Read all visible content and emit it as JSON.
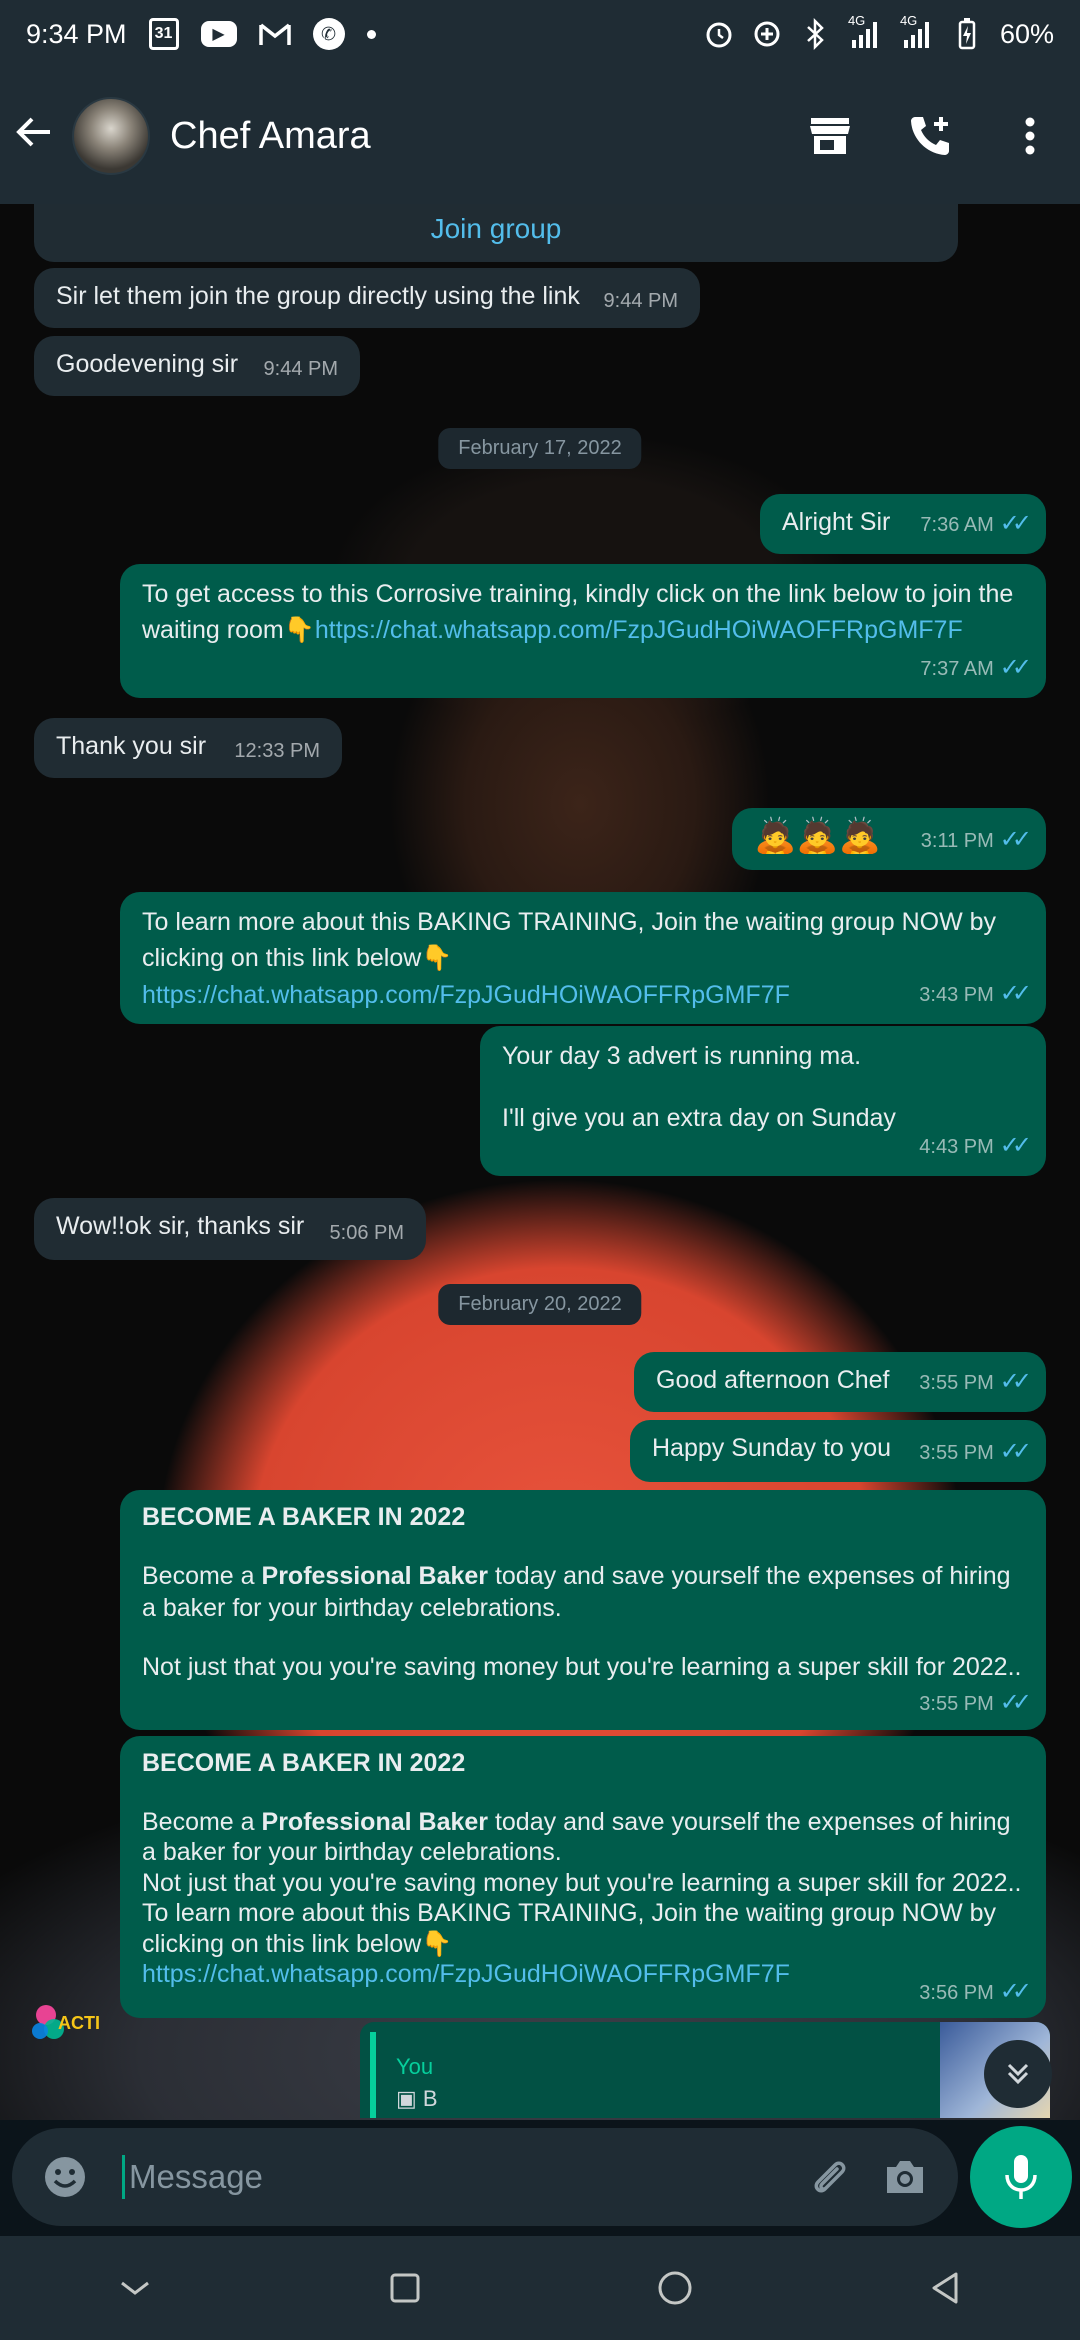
{
  "status_bar": {
    "time": "9:34 PM",
    "calendar_day": "31",
    "network1": "4G",
    "network2": "4G",
    "battery": "60%"
  },
  "header": {
    "contact_name": "Chef Amara"
  },
  "chat": {
    "join_group_label": "Join group",
    "messages": [
      {
        "dir": "in",
        "text": "Sir let them join the group directly using the link",
        "time": "9:44 PM"
      },
      {
        "dir": "in",
        "text": "Goodevening sir",
        "time": "9:44 PM"
      },
      {
        "type": "date",
        "text": "February 17, 2022"
      },
      {
        "dir": "out",
        "text": "Alright Sir",
        "time": "7:36 AM"
      },
      {
        "dir": "out",
        "text": "To get access to this Corrosive training, kindly click on the link below to join the waiting room👇",
        "link": "https://chat.whatsapp.com/FzpJGudHOiWAOFFRpGMF7F",
        "time": "7:37 AM"
      },
      {
        "dir": "in",
        "text": "Thank you sir",
        "time": "12:33 PM"
      },
      {
        "dir": "out",
        "text": "🙇🙇🙇",
        "time": "3:11 PM"
      },
      {
        "dir": "out",
        "text": "To learn more about this BAKING TRAINING, Join the waiting group NOW by clicking on this link below👇",
        "link": "https://chat.whatsapp.com/FzpJGudHOiWAOFFRpGMF7F",
        "time": "3:43 PM"
      },
      {
        "dir": "out",
        "text_line1": "Your day 3 advert is running ma.",
        "text_line2": "I'll give you an extra day on Sunday",
        "time": "4:43 PM"
      },
      {
        "dir": "in",
        "text": "Wow!!ok sir, thanks sir",
        "time": "5:06 PM"
      },
      {
        "type": "date",
        "text": "February 20, 2022"
      },
      {
        "dir": "out",
        "text": "Good afternoon Chef",
        "time": "3:55 PM"
      },
      {
        "dir": "out",
        "text": "Happy Sunday to you",
        "time": "3:55 PM"
      },
      {
        "dir": "out",
        "heading": "BECOME A BAKER IN 2022",
        "para1_pre": "Become a ",
        "para1_bold": "Professional Baker",
        "para1_post": " today and save yourself the expenses of hiring a baker for your birthday celebrations.",
        "para2": "Not just that you you're saving money but you're learning a super skill for 2022..",
        "time": "3:55 PM"
      },
      {
        "dir": "out",
        "heading": "BECOME A BAKER IN 2022",
        "para1_pre": "Become a ",
        "para1_bold": "Professional Baker",
        "para1_post": " today and save yourself the expenses of hiring a baker for your birthday celebrations.",
        "para2": "Not just that you you're saving money but you're learning a super skill for 2022..",
        "para3": "To learn more about this BAKING TRAINING, Join the waiting group NOW by clicking on this link below👇",
        "link": "https://chat.whatsapp.com/FzpJGudHOiWAOFFRpGMF7F",
        "time": "3:56 PM"
      }
    ],
    "quoted": {
      "author": "You",
      "preview": "B"
    },
    "side_logo_text": "ACTI"
  },
  "composer": {
    "placeholder": "Message"
  },
  "icons": {
    "back": "back-arrow-icon",
    "shop": "storefront-icon",
    "add_call": "add-call-icon",
    "more": "more-vert-icon",
    "emoji": "emoji-icon",
    "attach": "paperclip-icon",
    "camera": "camera-icon",
    "mic": "mic-icon",
    "scroll_down": "double-chevron-down-icon"
  },
  "colors": {
    "header_bg": "#1f2c34",
    "incoming_bubble": "#202c33",
    "outgoing_bubble": "#005c4b",
    "link": "#53bdeb",
    "accent": "#00a884"
  }
}
